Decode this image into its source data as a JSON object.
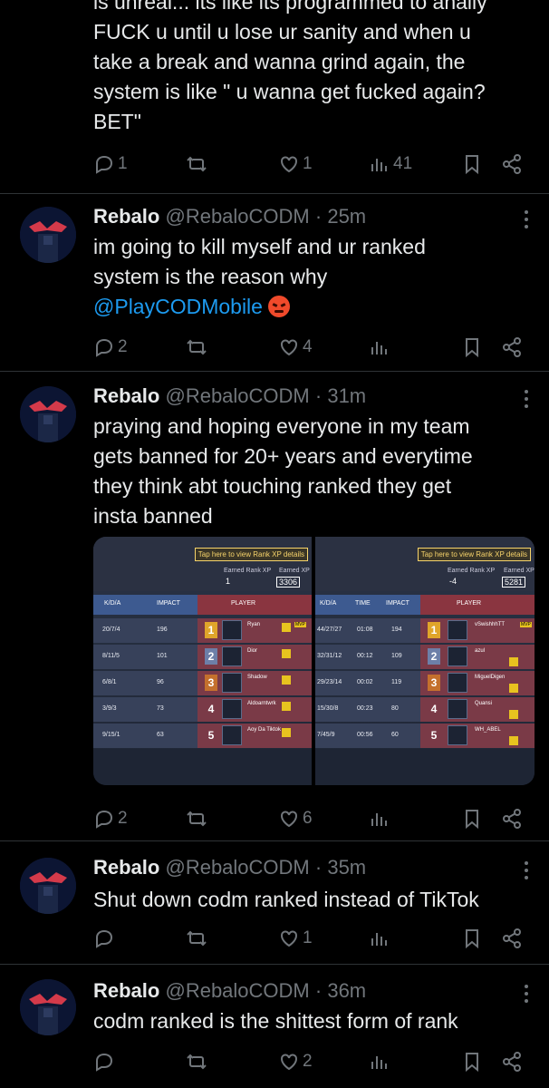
{
  "colors": {
    "background": "#000000",
    "text": "#e7e9ea",
    "muted": "#71767b",
    "link": "#1d9bf0",
    "divider": "#2f3336"
  },
  "prev_tweet": {
    "lines": [
      "is unreal... its like its programmed to anally",
      "FUCK u until u lose ur sanity and when u",
      "take a break and wanna grind again, the",
      "system is like \" u wanna get fucked again?",
      "BET\""
    ],
    "replies": "1",
    "retweets": "",
    "likes": "1",
    "views": "41"
  },
  "tweets": [
    {
      "name": "Rebalo",
      "handle": "@RebaloCODM",
      "dot": "·",
      "time": "25m",
      "lines": [
        "im going to kill myself and ur ranked",
        "system is the reason why"
      ],
      "mention": "@PlayCODMobile",
      "emoji": "angry-face-emoji",
      "replies": "2",
      "retweets": "",
      "likes": "4",
      "views": ""
    },
    {
      "name": "Rebalo",
      "handle": "@RebaloCODM",
      "dot": "·",
      "time": "31m",
      "lines": [
        "praying and hoping everyone in my team",
        "gets banned for 20+ years and everytime",
        "they think abt touching ranked they get",
        "insta banned"
      ],
      "replies": "2",
      "retweets": "",
      "likes": "6",
      "views": ""
    },
    {
      "name": "Rebalo",
      "handle": "@RebaloCODM",
      "dot": "·",
      "time": "35m",
      "lines": [
        "Shut down codm ranked instead of TikTok"
      ],
      "replies": "",
      "retweets": "",
      "likes": "1",
      "views": ""
    },
    {
      "name": "Rebalo",
      "handle": "@RebaloCODM",
      "dot": "·",
      "time": "36m",
      "lines": [
        "codm ranked is the shittest form of rank"
      ],
      "replies": "",
      "retweets": "",
      "likes": "2",
      "views": ""
    }
  ],
  "media": {
    "left": {
      "tap_hint": "Tap here to view Rank XP details",
      "earned_label": "Earned Rank XP",
      "earned_value": "1",
      "earned_right_label": "Earned XP",
      "earned_right_value": "3306",
      "headers": [
        "K/D/A",
        "IMPACT",
        "PLAYER"
      ],
      "rows": [
        {
          "kda": "20/7/4",
          "impact": "196",
          "rank": "1",
          "player": "Ryan",
          "mvp": "MVP"
        },
        {
          "kda": "8/11/5",
          "impact": "101",
          "rank": "2",
          "player": "Dior"
        },
        {
          "kda": "6/8/1",
          "impact": "96",
          "rank": "3",
          "player": "Shadow"
        },
        {
          "kda": "3/9/3",
          "impact": "73",
          "rank": "4",
          "player": "Aldoarntwrk"
        },
        {
          "kda": "9/15/1",
          "impact": "63",
          "rank": "5",
          "player": "Aoy Da Tiktok"
        }
      ]
    },
    "right": {
      "tap_hint": "Tap here to view Rank XP details",
      "earned_label": "Earned Rank XP",
      "earned_value": "-4",
      "earned_right_label": "Earned XP",
      "earned_right_value": "5281",
      "headers": [
        "K/D/A",
        "TIME",
        "IMPACT",
        "PLAYER"
      ],
      "rows": [
        {
          "kda": "44/27/27",
          "time": "01:08",
          "impact": "194",
          "rank": "1",
          "player": "vSwishhhTT",
          "mvp": "MVP"
        },
        {
          "kda": "32/31/12",
          "time": "00:12",
          "impact": "109",
          "rank": "2",
          "player": "azul"
        },
        {
          "kda": "29/23/14",
          "time": "00:02",
          "impact": "119",
          "rank": "3",
          "player": "MiguelDigen"
        },
        {
          "kda": "15/30/8",
          "time": "00:23",
          "impact": "80",
          "rank": "4",
          "player": "Quansi"
        },
        {
          "kda": "7/45/9",
          "time": "00:56",
          "impact": "60",
          "rank": "5",
          "player": "WH_ABEL"
        }
      ]
    }
  }
}
